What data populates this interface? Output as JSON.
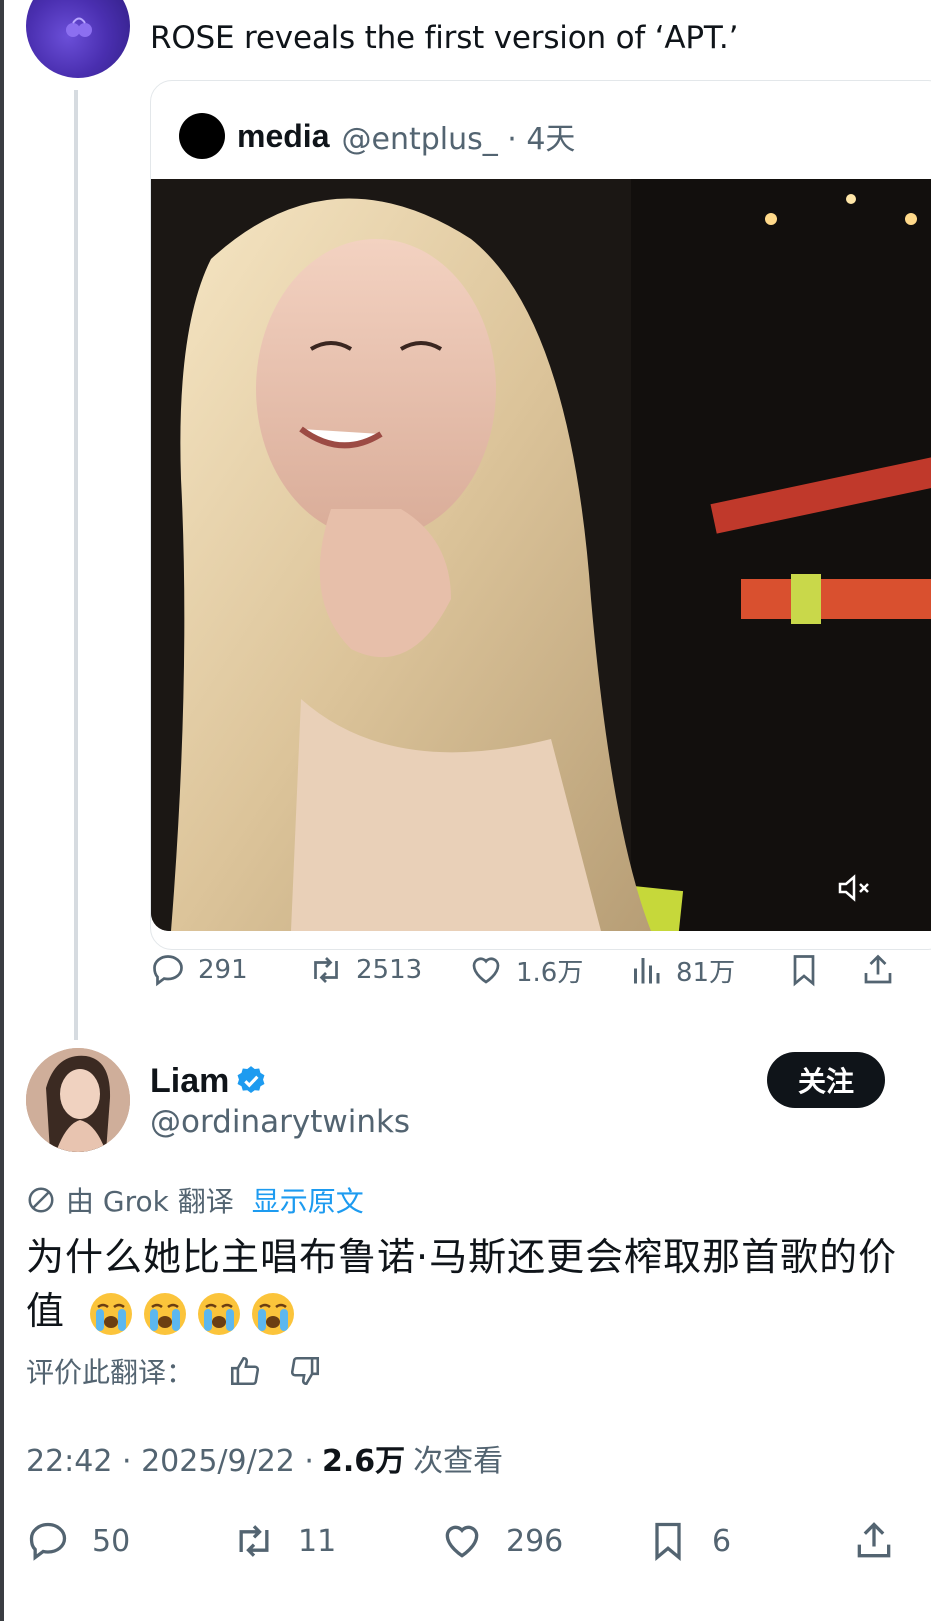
{
  "parent_tweet": {
    "text": "ROSE reveals the first version of ‘APT.’",
    "quote": {
      "name": "media",
      "handle_time": "@entplus_ · 4天",
      "media_description_icon": "mute-icon"
    },
    "stats": {
      "replies": "291",
      "retweets": "2513",
      "likes": "1.6万",
      "views": "81万"
    }
  },
  "reply_tweet": {
    "name": "Liam",
    "handle": "@ordinarytwinks",
    "follow_label": "关注",
    "translated_by": "由 Grok 翻译",
    "show_original": "显示原文",
    "text": "为什么她比主唱布鲁诺·马斯还更会榨取那首歌的价值",
    "emoji_count": 4,
    "rate_label": "评价此翻译：",
    "time_date": "22:42 · 2025/9/22 ·",
    "views_count": "2.6万",
    "views_label": "次查看",
    "stats": {
      "replies": "50",
      "retweets": "11",
      "likes": "296",
      "bookmarks": "6"
    }
  },
  "colors": {
    "text": "#0f1419",
    "muted": "#536471",
    "link": "#1d9bf0",
    "follow_bg": "#0f1419",
    "verified": "#1d9bf0"
  }
}
